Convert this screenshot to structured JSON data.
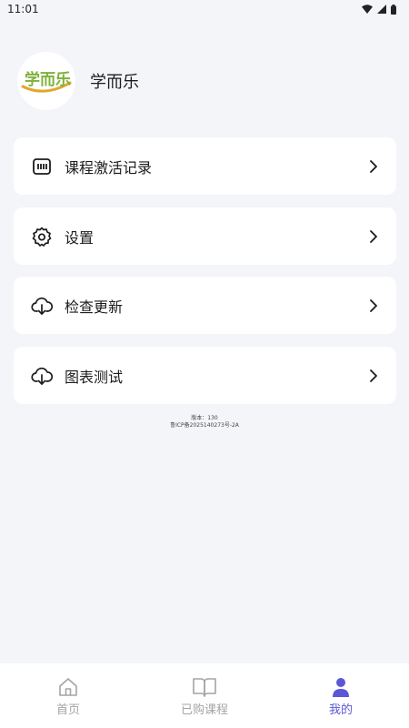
{
  "status": {
    "time": "11:01"
  },
  "profile": {
    "app_name": "学而乐",
    "logo_text": "学而乐"
  },
  "menu": [
    {
      "label": "课程激活记录",
      "icon": "barcode-icon"
    },
    {
      "label": "设置",
      "icon": "gear-icon"
    },
    {
      "label": "检查更新",
      "icon": "cloud-download-icon"
    },
    {
      "label": "图表测试",
      "icon": "cloud-download-icon"
    }
  ],
  "footer": {
    "version": "版本：130",
    "icp": "鲁ICP备2025140273号-2A"
  },
  "tabs": [
    {
      "label": "首页",
      "icon": "home-icon",
      "active": false
    },
    {
      "label": "已购课程",
      "icon": "book-icon",
      "active": false
    },
    {
      "label": "我的",
      "icon": "user-icon",
      "active": true
    }
  ],
  "colors": {
    "accent": "#5b57d6",
    "background": "#f4f5f9",
    "card": "#ffffff",
    "inactive": "#a4a4a8"
  }
}
